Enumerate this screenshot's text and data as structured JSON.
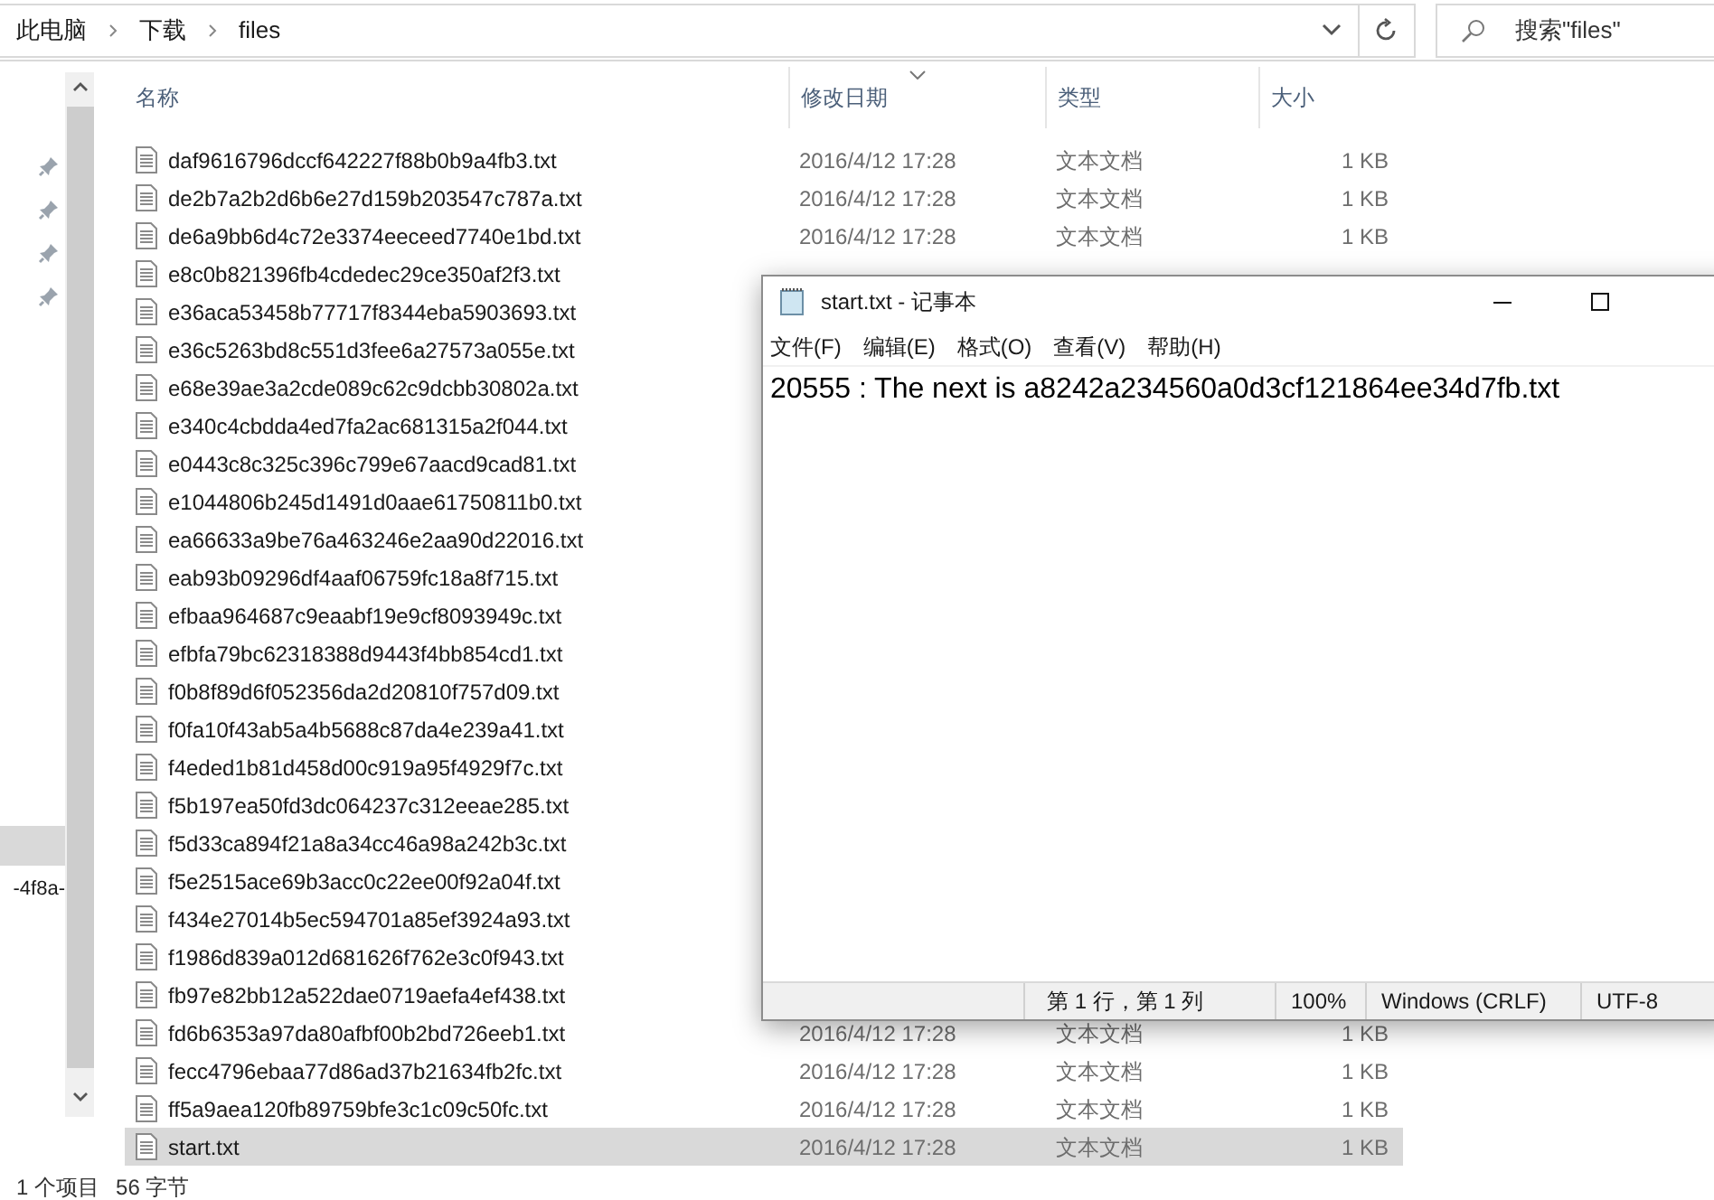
{
  "breadcrumb": [
    "此电脑",
    "下载",
    "files"
  ],
  "search": {
    "placeholder": "搜索\"files\""
  },
  "nav_pane": {
    "items": [
      {
        "selected": true
      },
      {
        "label": "-4f8a-",
        "selected": false
      }
    ]
  },
  "table": {
    "columns": [
      {
        "label": "名称",
        "sorted": false
      },
      {
        "label": "修改日期",
        "sorted": true
      },
      {
        "label": "类型",
        "sorted": false
      },
      {
        "label": "大小",
        "sorted": false
      }
    ],
    "rows": [
      {
        "name": "daf9616796dccf642227f88b0b9a4fb3.txt",
        "date": "2016/4/12 17:28",
        "type": "文本文档",
        "size": "1 KB",
        "selected": false
      },
      {
        "name": "de2b7a2b2d6b6e27d159b203547c787a.txt",
        "date": "2016/4/12 17:28",
        "type": "文本文档",
        "size": "1 KB",
        "selected": false
      },
      {
        "name": "de6a9bb6d4c72e3374eeceed7740e1bd.txt",
        "date": "2016/4/12 17:28",
        "type": "文本文档",
        "size": "1 KB",
        "selected": false
      },
      {
        "name": "e8c0b821396fb4cdedec29ce350af2f3.txt",
        "selected": false
      },
      {
        "name": "e36aca53458b77717f8344eba5903693.txt",
        "selected": false
      },
      {
        "name": "e36c5263bd8c551d3fee6a27573a055e.txt",
        "selected": false
      },
      {
        "name": "e68e39ae3a2cde089c62c9dcbb30802a.txt",
        "selected": false
      },
      {
        "name": "e340c4cbdda4ed7fa2ac681315a2f044.txt",
        "selected": false
      },
      {
        "name": "e0443c8c325c396c799e67aacd9cad81.txt",
        "selected": false
      },
      {
        "name": "e1044806b245d1491d0aae61750811b0.txt",
        "selected": false
      },
      {
        "name": "ea66633a9be76a463246e2aa90d22016.txt",
        "selected": false
      },
      {
        "name": "eab93b09296df4aaf06759fc18a8f715.txt",
        "selected": false
      },
      {
        "name": "efbaa964687c9eaabf19e9cf8093949c.txt",
        "selected": false
      },
      {
        "name": "efbfa79bc62318388d9443f4bb854cd1.txt",
        "selected": false
      },
      {
        "name": "f0b8f89d6f052356da2d20810f757d09.txt",
        "selected": false
      },
      {
        "name": "f0fa10f43ab5a4b5688c87da4e239a41.txt",
        "selected": false
      },
      {
        "name": "f4eded1b81d458d00c919a95f4929f7c.txt",
        "selected": false
      },
      {
        "name": "f5b197ea50fd3dc064237c312eeae285.txt",
        "selected": false
      },
      {
        "name": "f5d33ca894f21a8a34cc46a98a242b3c.txt",
        "selected": false
      },
      {
        "name": "f5e2515ace69b3acc0c22ee00f92a04f.txt",
        "selected": false
      },
      {
        "name": "f434e27014b5ec594701a85ef3924a93.txt",
        "selected": false
      },
      {
        "name": "f1986d839a012d681626f762e3c0f943.txt",
        "selected": false
      },
      {
        "name": "fb97e82bb12a522dae0719aefa4ef438.txt",
        "selected": false
      },
      {
        "name": "fd6b6353a97da80afbf00b2bd726eeb1.txt",
        "date": "2016/4/12 17:28",
        "type": "文本文档",
        "size": "1 KB",
        "selected": false
      },
      {
        "name": "fecc4796ebaa77d86ad37b21634fb2fc.txt",
        "date": "2016/4/12 17:28",
        "type": "文本文档",
        "size": "1 KB",
        "selected": false
      },
      {
        "name": "ff5a9aea120fb89759bfe3c1c09c50fc.txt",
        "date": "2016/4/12 17:28",
        "type": "文本文档",
        "size": "1 KB",
        "selected": false
      },
      {
        "name": "start.txt",
        "date": "2016/4/12 17:28",
        "type": "文本文档",
        "size": "1 KB",
        "selected": true
      }
    ]
  },
  "status_bar": [
    "1 个项目",
    "56 字节"
  ],
  "notepad": {
    "title": "start.txt - 记事本",
    "menu": [
      "文件(F)",
      "编辑(E)",
      "格式(O)",
      "查看(V)",
      "帮助(H)"
    ],
    "text": "20555 : The next is a8242a234560a0d3cf121864ee34d7fb.txt",
    "status": [
      "第 1 行，第 1 列",
      "100%",
      "Windows (CRLF)",
      "UTF-8"
    ]
  }
}
